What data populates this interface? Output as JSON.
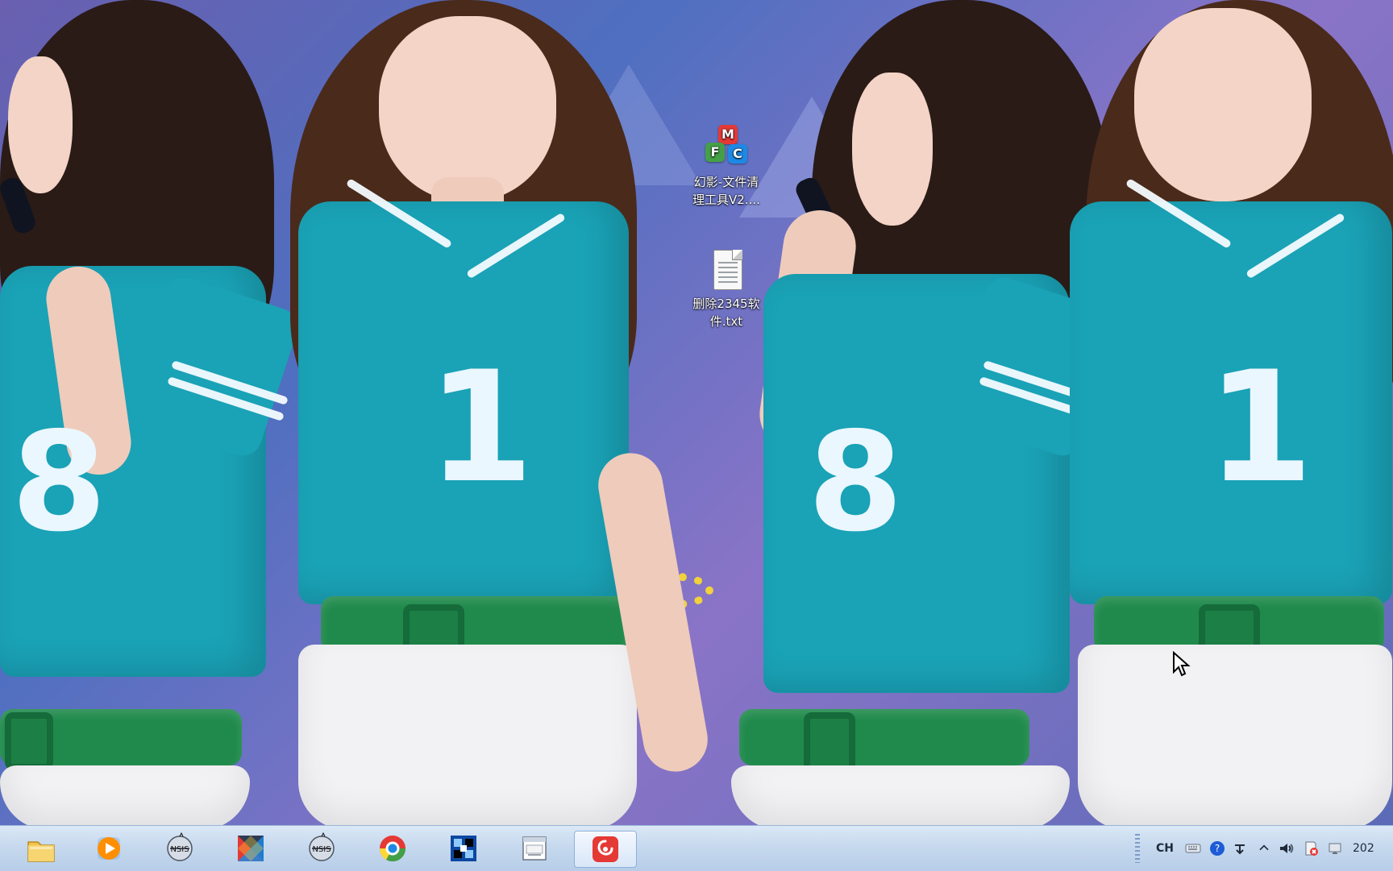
{
  "desktop": {
    "icons": [
      {
        "label_line1": "幻影-文件清",
        "label_line2": "理工具V2....",
        "icon": "mfc-cubes-icon"
      },
      {
        "label_line1": "删除2345软",
        "label_line2": "件.txt",
        "icon": "text-file-icon"
      }
    ],
    "wallpaper": {
      "numbers_left": {
        "n1": "8",
        "n2": "1"
      },
      "numbers_right": {
        "n1": "8",
        "n2": "1"
      }
    }
  },
  "taskbar": {
    "pinned": [
      {
        "icon": "folder-icon",
        "label": ""
      },
      {
        "icon": "media-player-icon",
        "label": ""
      },
      {
        "icon": "nsis-icon",
        "label": ""
      },
      {
        "icon": "triangle-app-icon",
        "label": ""
      },
      {
        "icon": "nsis-icon",
        "label": ""
      },
      {
        "icon": "chrome-icon",
        "label": ""
      },
      {
        "icon": "cube-app-icon",
        "label": ""
      },
      {
        "icon": "window-app-icon",
        "label": ""
      },
      {
        "icon": "netease-music-icon",
        "label": ""
      }
    ],
    "tray": {
      "language": "CH",
      "clock_partial": "202"
    }
  },
  "colors": {
    "accent_teal": "#1aa2b6",
    "belt_green": "#1f8a4b",
    "taskbar_blue": "#c6d9ee"
  }
}
